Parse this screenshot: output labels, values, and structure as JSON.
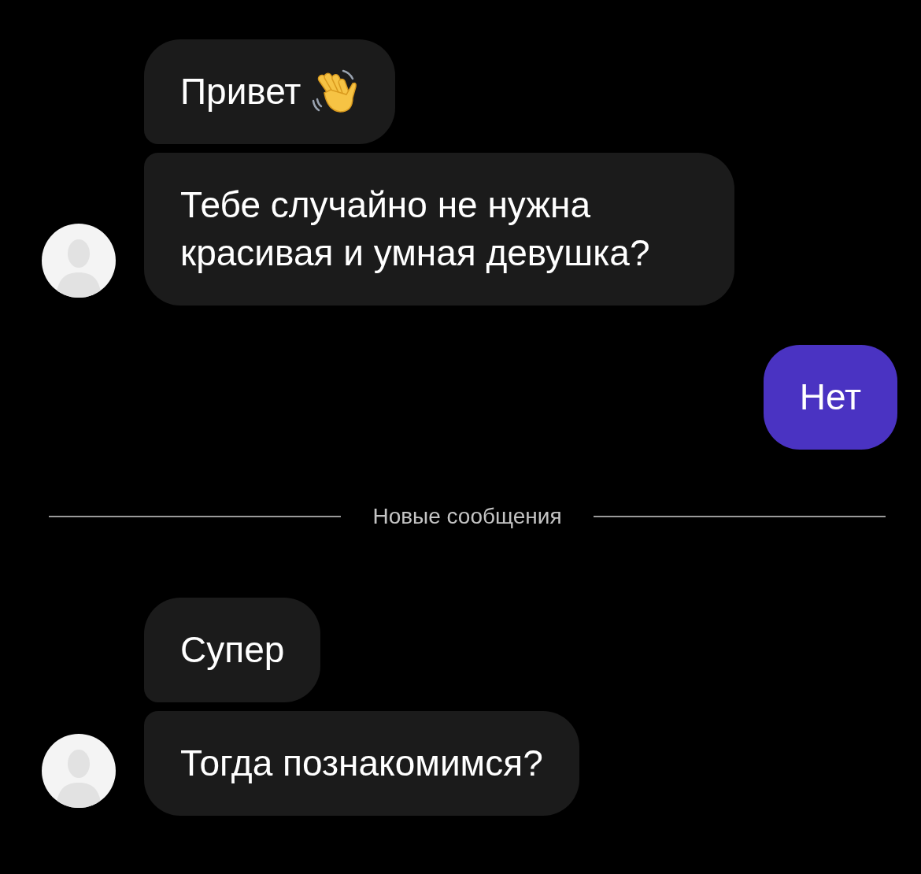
{
  "chat": [
    {
      "kind": "incoming",
      "messages": [
        {
          "text": "Привет",
          "emoji": true
        },
        {
          "text": "Тебе случайно не нужна красивая и умная девушка?",
          "emoji": false
        }
      ]
    },
    {
      "kind": "outgoing",
      "messages": [
        {
          "text": "Нет",
          "emoji": false
        }
      ]
    },
    {
      "kind": "divider",
      "text": "Новые сообщения"
    },
    {
      "kind": "incoming",
      "messages": [
        {
          "text": "Супер",
          "emoji": false
        },
        {
          "text": "Тогда познакомимся?",
          "emoji": false
        }
      ]
    }
  ]
}
